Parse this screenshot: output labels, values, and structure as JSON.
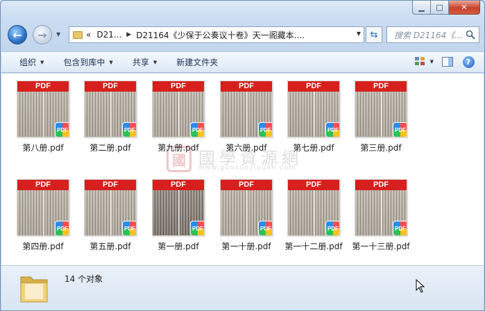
{
  "address": {
    "prefix": "«",
    "segments": [
      "D21...",
      "D21164《少保于公奏议十卷》天一阁藏本...."
    ],
    "search_placeholder": "搜索 D21164《..."
  },
  "toolbar": {
    "organize": "组织",
    "include_library": "包含到库中",
    "share": "共享",
    "new_folder": "新建文件夹"
  },
  "files": [
    {
      "name": "第八册.pdf"
    },
    {
      "name": "第二册.pdf"
    },
    {
      "name": "第九册.pdf"
    },
    {
      "name": "第六册.pdf"
    },
    {
      "name": "第七册.pdf"
    },
    {
      "name": "第三册.pdf"
    },
    {
      "name": "第四册.pdf"
    },
    {
      "name": "第五册.pdf"
    },
    {
      "name": "第一册.pdf"
    },
    {
      "name": "第一十册.pdf"
    },
    {
      "name": "第一十二册.pdf"
    },
    {
      "name": "第一十三册.pdf"
    }
  ],
  "thumb_band_label": "PDF",
  "badge_label": "PDF",
  "watermark": {
    "seal": "國",
    "title": "國學資源網",
    "url": "www.guoxueziyuan.com"
  },
  "status": {
    "count_text": "14 个对象"
  },
  "colors": {
    "pdf_red": "#d7201d",
    "toolbar_text": "#1e3050",
    "close_button": "#c7432b"
  }
}
